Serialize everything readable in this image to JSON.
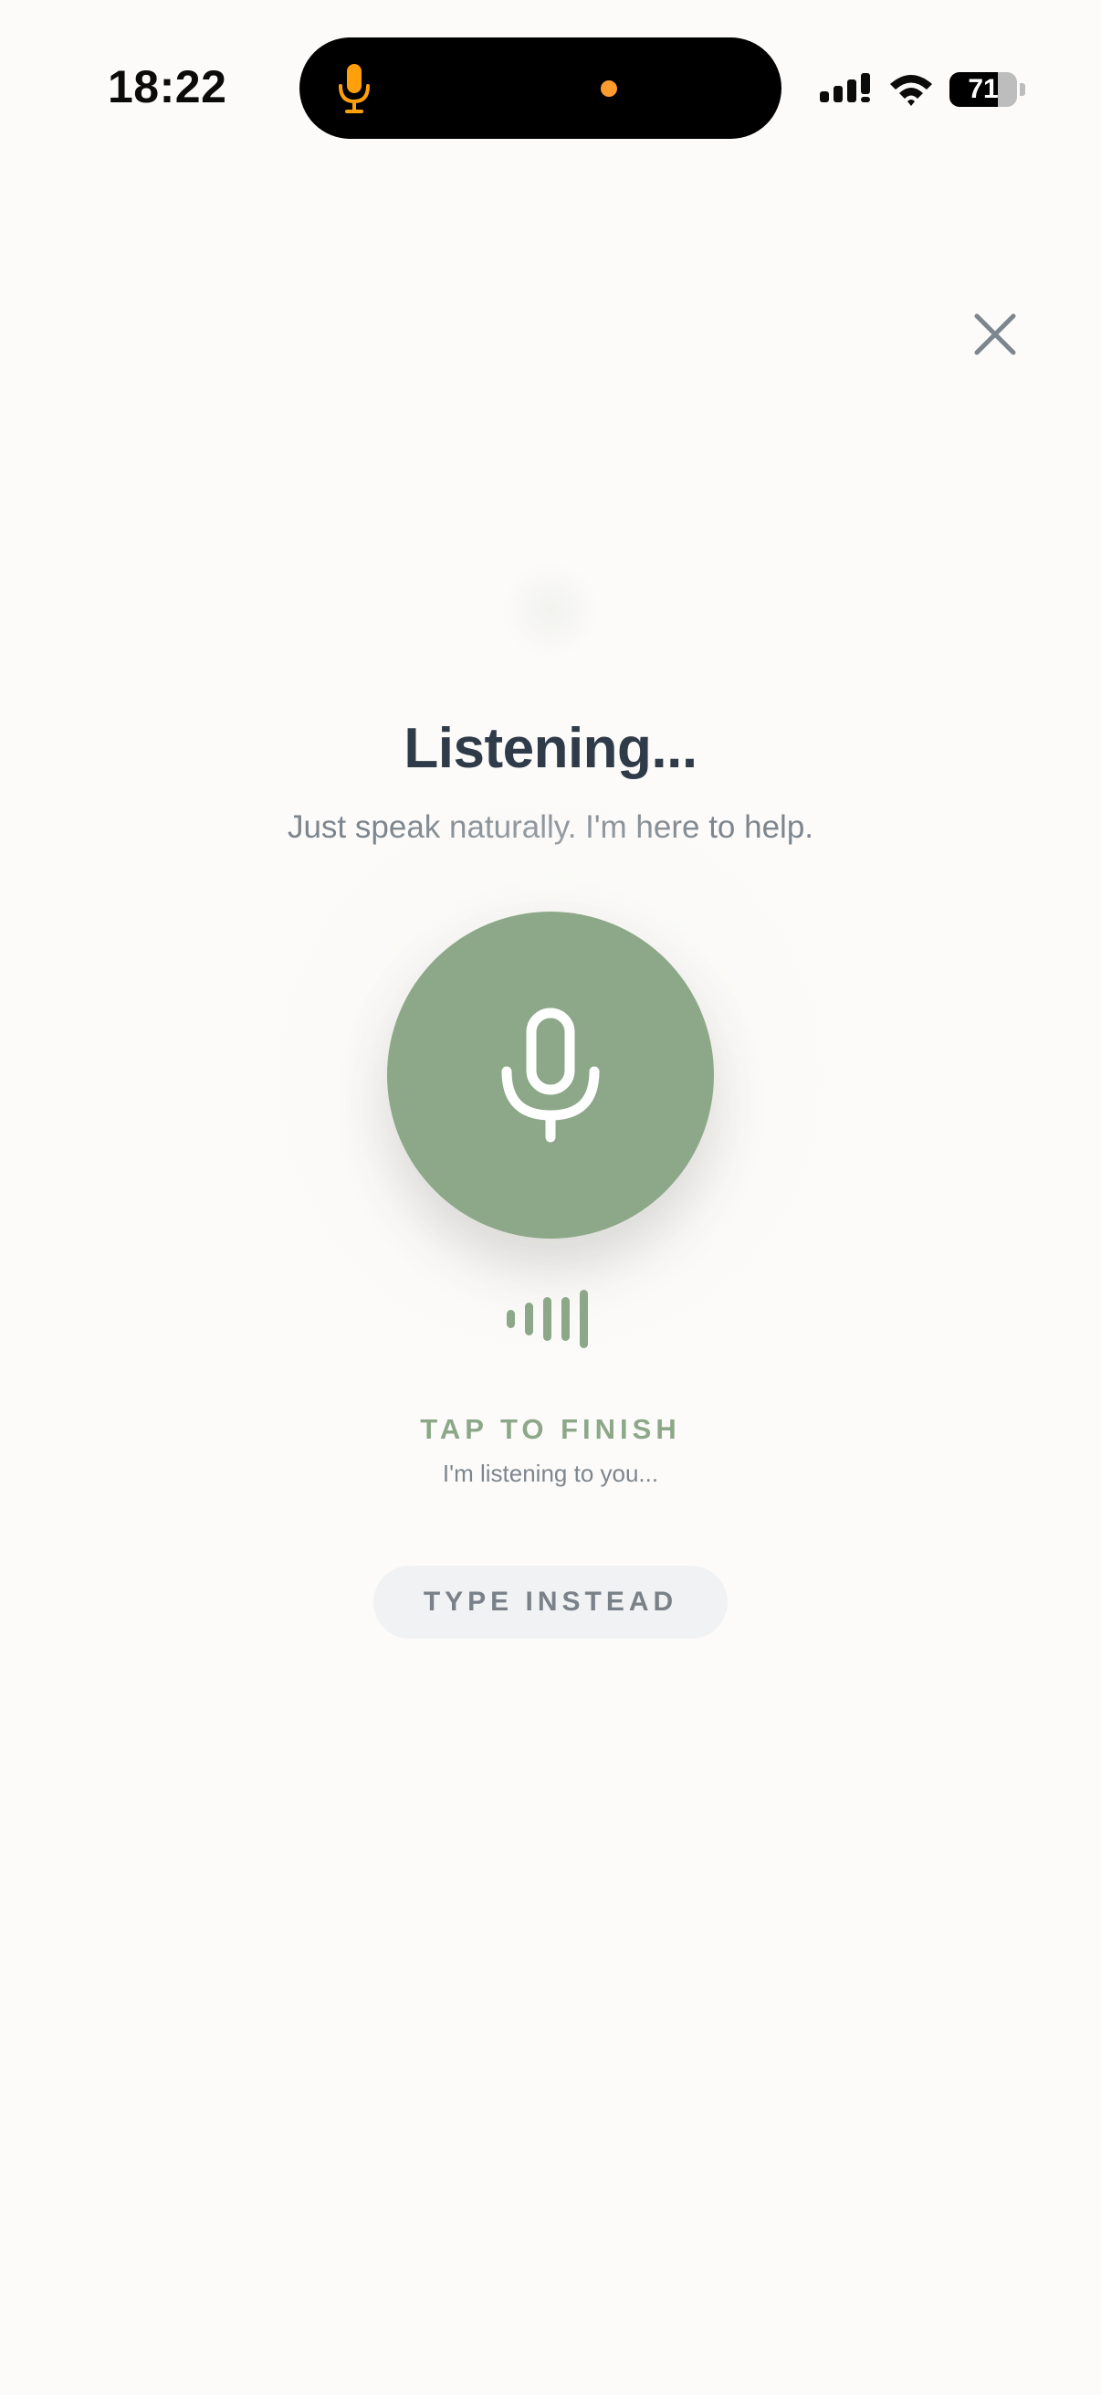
{
  "status_bar": {
    "time": "18:22",
    "battery_level": "71",
    "battery_fraction": 0.71,
    "icons": {
      "island_mic": "microphone-icon",
      "signal": "cellular-signal-icon",
      "wifi": "wifi-icon",
      "battery": "battery-icon"
    },
    "colors": {
      "island_mic": "#ff9f0a",
      "recording_dot": "#ff9a2e"
    }
  },
  "header": {
    "close_icon": "close-icon"
  },
  "main": {
    "title": "Listening...",
    "subtitle": "Just speak naturally. I'm here to help.",
    "mic_icon": "microphone-icon",
    "waveform_icon": "waveform-icon",
    "tap_label": "TAP TO FINISH",
    "listening_note": "I'm listening to you...",
    "type_instead_label": "TYPE INSTEAD"
  },
  "colors": {
    "accent": "#8ca888",
    "title": "#2f3b48",
    "muted_text": "#7d868e",
    "background": "#fcfbf9",
    "secondary_button_bg": "#f1f2f3"
  }
}
